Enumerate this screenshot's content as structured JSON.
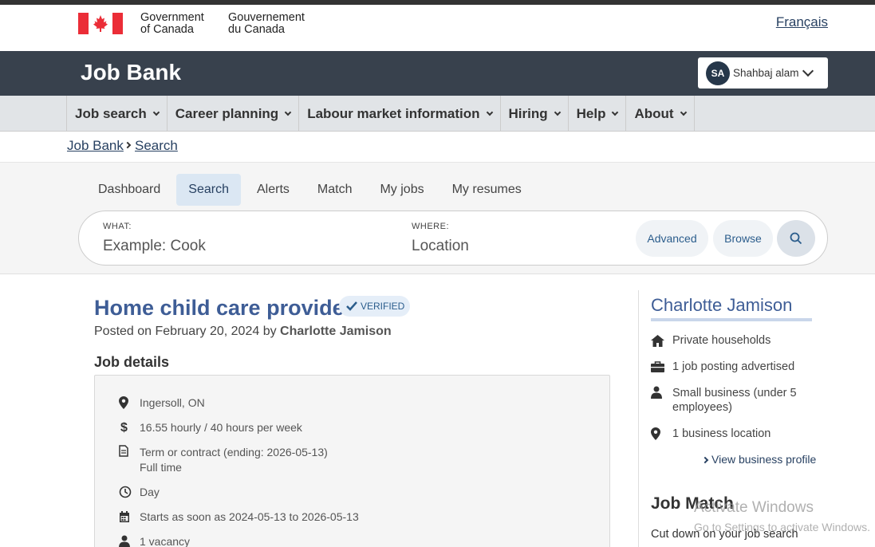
{
  "gov": {
    "en_line1": "Government",
    "en_line2": "of Canada",
    "fr_line1": "Gouvernement",
    "fr_line2": "du Canada",
    "language_link": "Français"
  },
  "header": {
    "title": "Job Bank",
    "user_initials": "SA",
    "user_name": "Shahbaj alam"
  },
  "menu": [
    "Job search",
    "Career planning",
    "Labour market information",
    "Hiring",
    "Help",
    "About"
  ],
  "breadcrumb": [
    "Job Bank",
    "Search"
  ],
  "tabs": [
    "Dashboard",
    "Search",
    "Alerts",
    "Match",
    "My jobs",
    "My resumes"
  ],
  "search": {
    "what_label": "WHAT:",
    "what_placeholder": "Example: Cook",
    "where_label": "WHERE:",
    "where_placeholder": "Location",
    "advanced": "Advanced",
    "browse": "Browse"
  },
  "job": {
    "title": "Home child care provider",
    "verified": "VERIFIED",
    "posted_prefix": "Posted on February 20, 2024 by",
    "employer": "Charlotte Jamison",
    "details_heading": "Job details",
    "location": "Ingersoll, ON",
    "salary": "16.55 hourly / 40 hours per week",
    "term": "Term or contract (ending: 2026-05-13)",
    "employment_type": "Full time",
    "shift": "Day",
    "start": "Starts as soon as 2024-05-13 to 2026-05-13",
    "vacancy": "1 vacancy"
  },
  "employer_card": {
    "name": "Charlotte Jamison",
    "industry": "Private households",
    "postings": "1 job posting advertised",
    "size": "Small business (under 5 employees)",
    "locations": "1 business location",
    "profile_link": "View business profile"
  },
  "job_match": {
    "title": "Job Match",
    "text": "Cut down on your job search"
  },
  "watermark": {
    "line1": "Activate Windows",
    "line2": "Go to Settings to activate Windows."
  },
  "colors": {
    "header_bg": "#38414d",
    "menu_bg": "#e1e4e7",
    "link": "#284162",
    "title_blue": "#3e5d96",
    "flag_red": "#eb2d37"
  }
}
